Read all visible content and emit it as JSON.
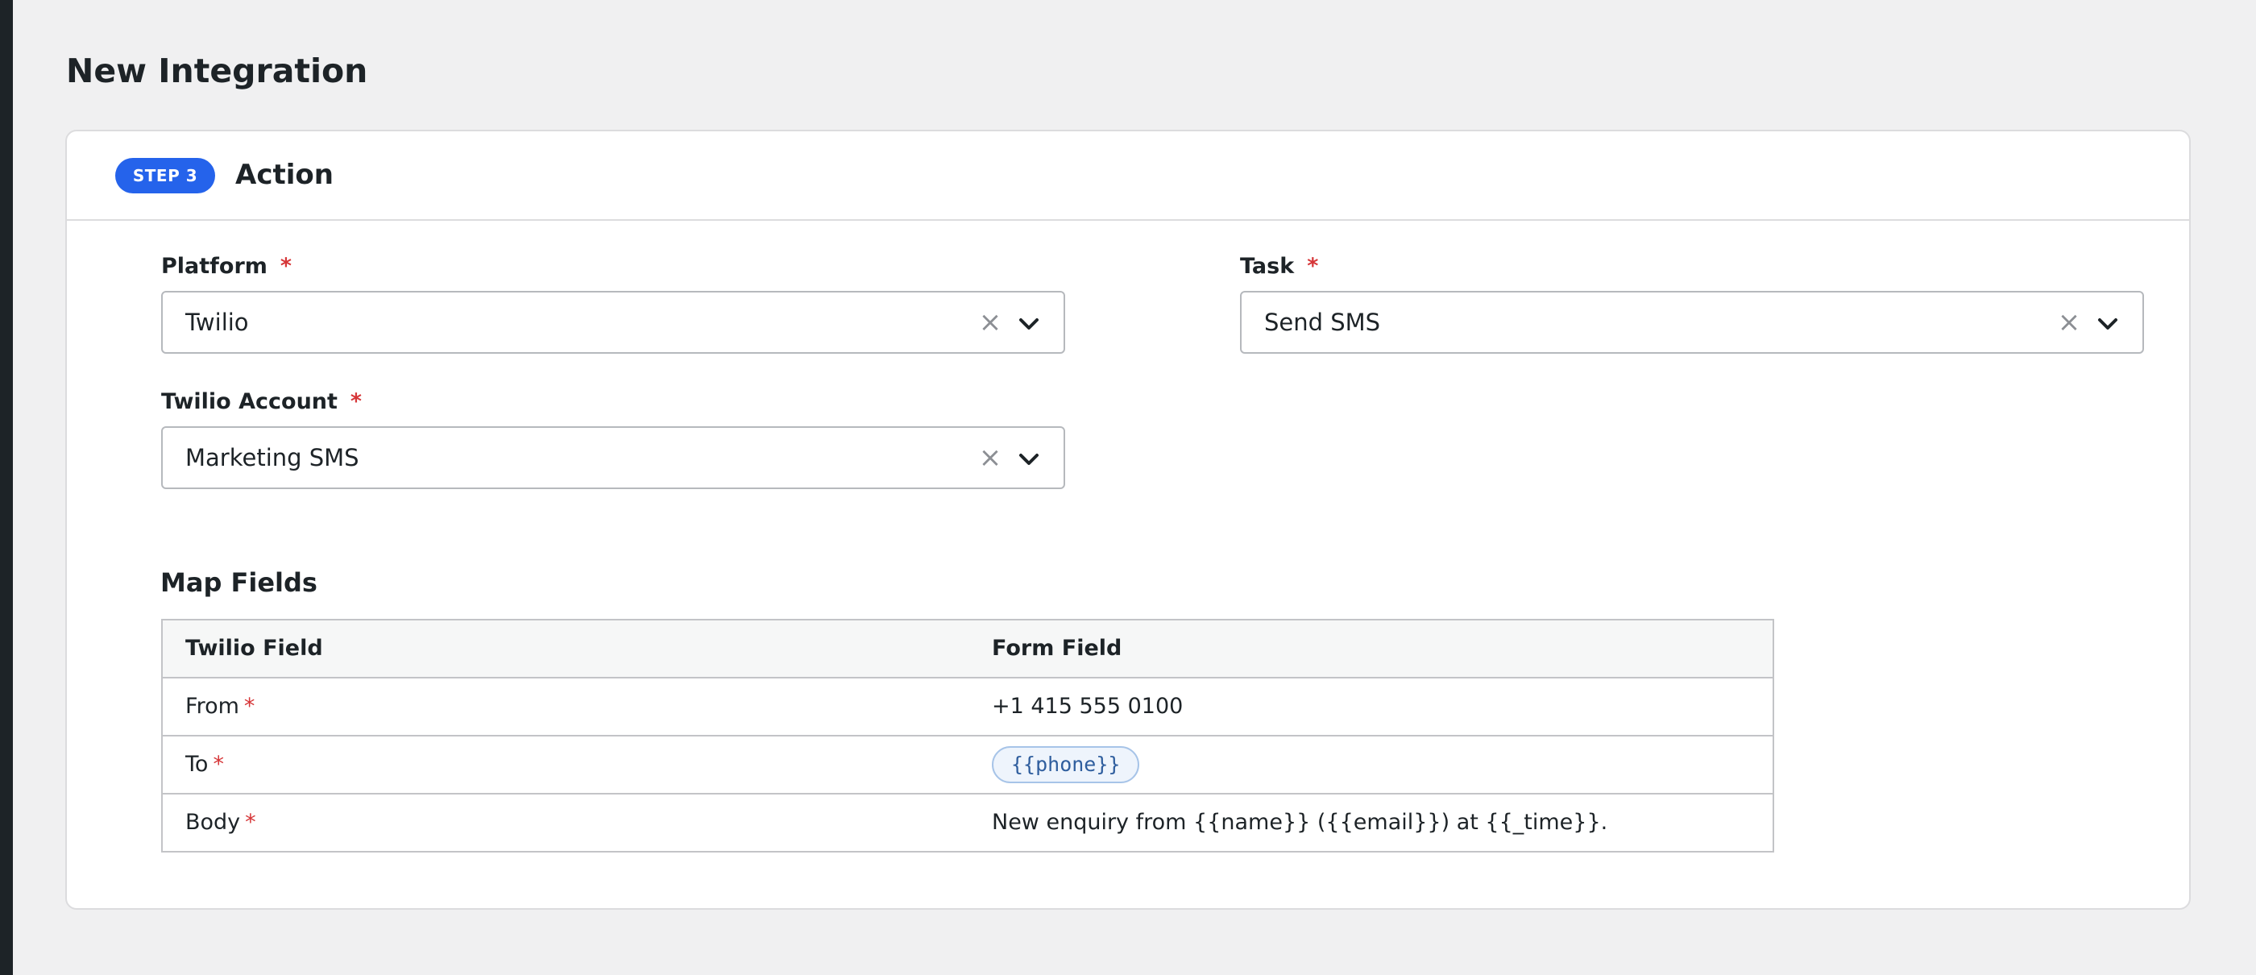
{
  "page": {
    "title": "New Integration"
  },
  "step": {
    "badge": "STEP 3",
    "title": "Action"
  },
  "fields": {
    "platform": {
      "label": "Platform",
      "required_mark": "*",
      "value": "Twilio",
      "clear_glyph": "×"
    },
    "task": {
      "label": "Task",
      "required_mark": "*",
      "value": "Send SMS",
      "clear_glyph": "×"
    },
    "account": {
      "label": "Twilio Account",
      "required_mark": "*",
      "value": "Marketing SMS",
      "clear_glyph": "×"
    }
  },
  "map_fields": {
    "title": "Map Fields",
    "headers": {
      "twilio_field": "Twilio Field",
      "form_field": "Form Field"
    },
    "rows": [
      {
        "field": "From",
        "required_mark": "*",
        "value": "+1 415 555 0100"
      },
      {
        "field": "To",
        "required_mark": "*",
        "value": "{{phone}}"
      },
      {
        "field": "Body",
        "required_mark": "*",
        "value": "New enquiry from {{name}} ({{email}}) at {{_time}}."
      }
    ]
  },
  "icons": {
    "clear": "close-icon",
    "dropdown": "chevron-down-icon"
  },
  "colors": {
    "accent": "#2563eb",
    "required": "#d63638",
    "background": "#f0f0f1",
    "card": "#ffffff",
    "sidebar": "#1d2327",
    "tag_text": "#2f5e9e"
  }
}
